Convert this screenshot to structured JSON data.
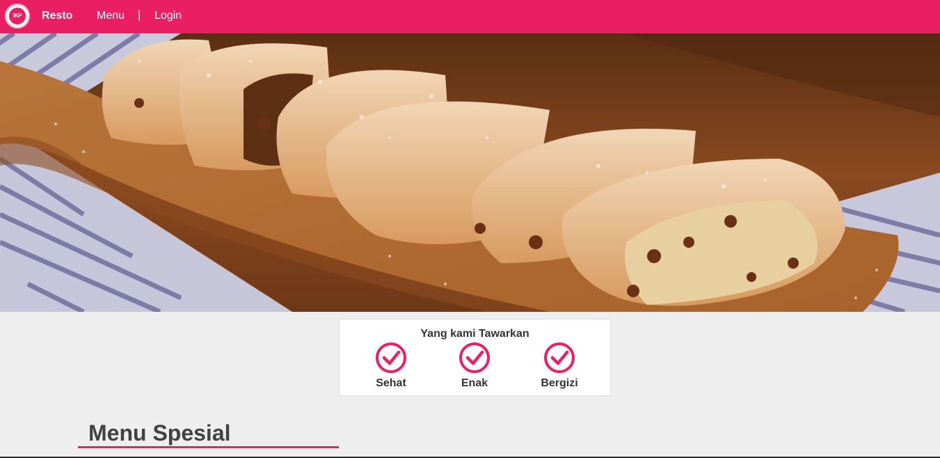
{
  "navbar": {
    "logo_text": "IKP",
    "brand": "Resto",
    "links": [
      {
        "label": "Menu"
      },
      {
        "label": "Login"
      }
    ],
    "separator": "|",
    "color": "#e91e63"
  },
  "offer": {
    "title": "Yang kami Tawarkan",
    "items": [
      {
        "label": "Sehat",
        "icon": "check-circle-icon"
      },
      {
        "label": "Enak",
        "icon": "check-circle-icon"
      },
      {
        "label": "Bergizi",
        "icon": "check-circle-icon"
      }
    ]
  },
  "section": {
    "title": "Menu Spesial"
  }
}
